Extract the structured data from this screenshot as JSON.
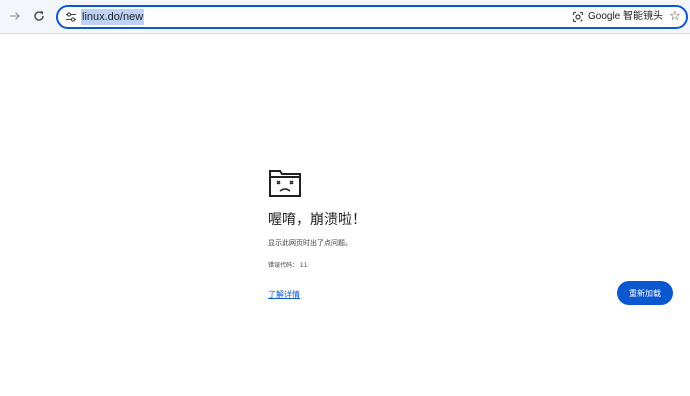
{
  "toolbar": {
    "forward_icon": "forward-arrow-icon",
    "reload_icon": "reload-icon",
    "url": "linux.do/new",
    "lens_label": "Google 智能镜头",
    "bookmark_icon": "star-icon"
  },
  "error": {
    "title": "喔唷，崩溃啦！",
    "message": "显示此网页时出了点问题。",
    "code": "错误代码： 11",
    "learn_more": "了解详情",
    "reload_button": "重新加载"
  },
  "colors": {
    "accent": "#0b57d0",
    "toolbar_bg": "#f3f6fb",
    "url_highlight": "#bcd3f7"
  }
}
